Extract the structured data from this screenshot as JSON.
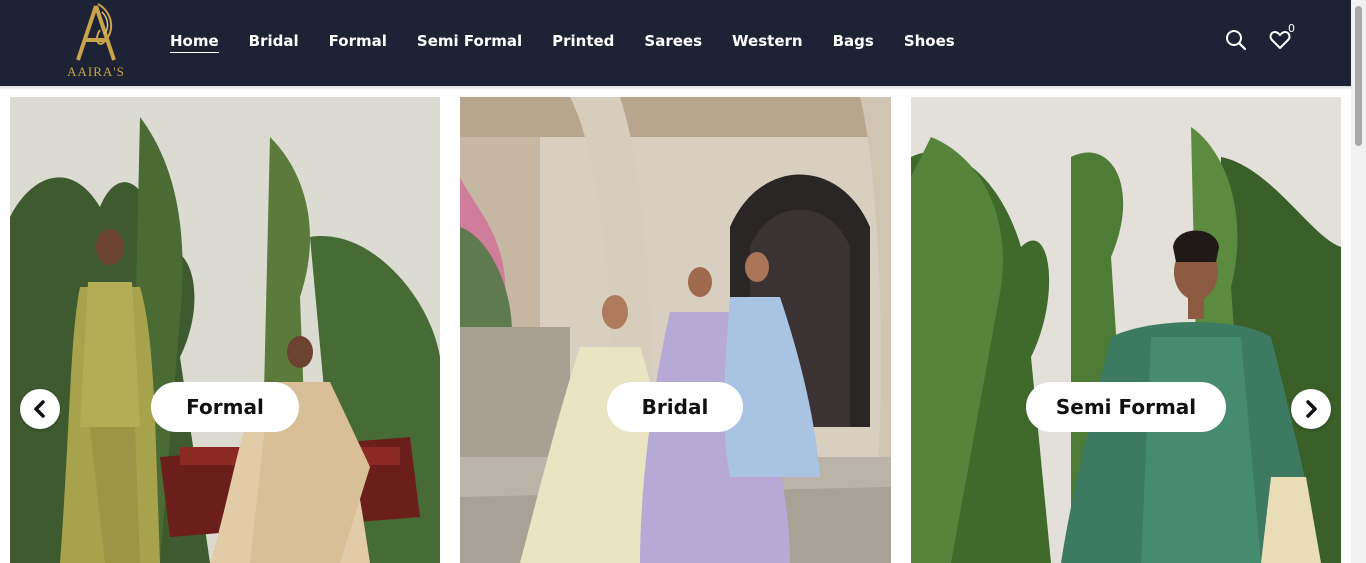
{
  "brand": {
    "name": "AAIRA'S",
    "accent": "#c9a44a",
    "header_bg": "#1e2235"
  },
  "nav": {
    "items": [
      {
        "label": "Home",
        "active": true
      },
      {
        "label": "Bridal"
      },
      {
        "label": "Formal"
      },
      {
        "label": "Semi Formal"
      },
      {
        "label": "Printed"
      },
      {
        "label": "Sarees"
      },
      {
        "label": "Western"
      },
      {
        "label": "Bags"
      },
      {
        "label": "Shoes"
      }
    ]
  },
  "header_icons": {
    "search": "search-icon",
    "wishlist": "heart-icon",
    "wishlist_count": "0"
  },
  "carousel": {
    "cards": [
      {
        "label": "Formal"
      },
      {
        "label": "Bridal"
      },
      {
        "label": "Semi Formal"
      }
    ],
    "prev_icon": "chevron-left-icon",
    "next_icon": "chevron-right-icon"
  }
}
